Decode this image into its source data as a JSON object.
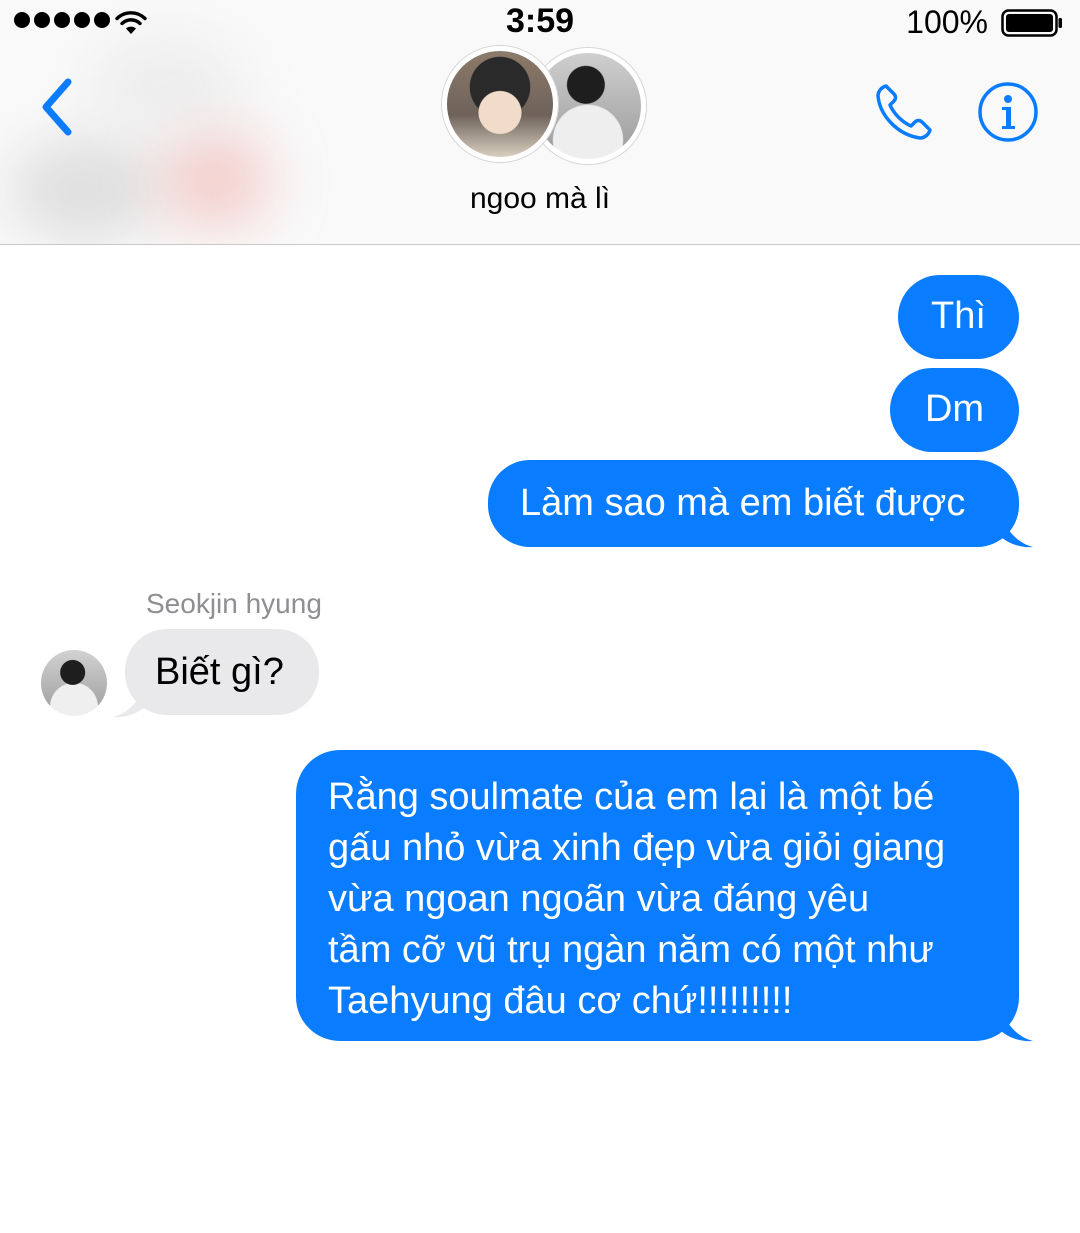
{
  "status_bar": {
    "time": "3:59",
    "battery_percent": "100%",
    "signal_bars": 5,
    "icons": [
      "signal-dots-icon",
      "wifi-icon",
      "battery-icon"
    ]
  },
  "nav": {
    "back_icon": "chevron-left-icon",
    "conversation_name": "ngoo mà lì",
    "call_icon": "phone-icon",
    "info_icon": "info-icon",
    "accent_color": "#0a7cff"
  },
  "messages": [
    {
      "direction": "outgoing",
      "text": "Thì"
    },
    {
      "direction": "outgoing",
      "text": "Dm"
    },
    {
      "direction": "outgoing",
      "text": "Làm sao mà em biết được"
    },
    {
      "direction": "incoming",
      "sender": "Seokjin hyung",
      "text": "Biết gì?"
    },
    {
      "direction": "outgoing",
      "lines": [
        "Rằng soulmate của em lại là một bé",
        "gấu nhỏ vừa xinh đẹp vừa giỏi giang",
        "vừa ngoan ngoãn vừa đáng yêu",
        "tầm cỡ vũ trụ ngàn năm có một như",
        "Taehyung đâu cơ chứ!!!!!!!!!"
      ]
    }
  ],
  "colors": {
    "outgoing_bubble": "#0a7cff",
    "incoming_bubble": "#e9e9eb",
    "sender_name": "#8e8e93"
  }
}
